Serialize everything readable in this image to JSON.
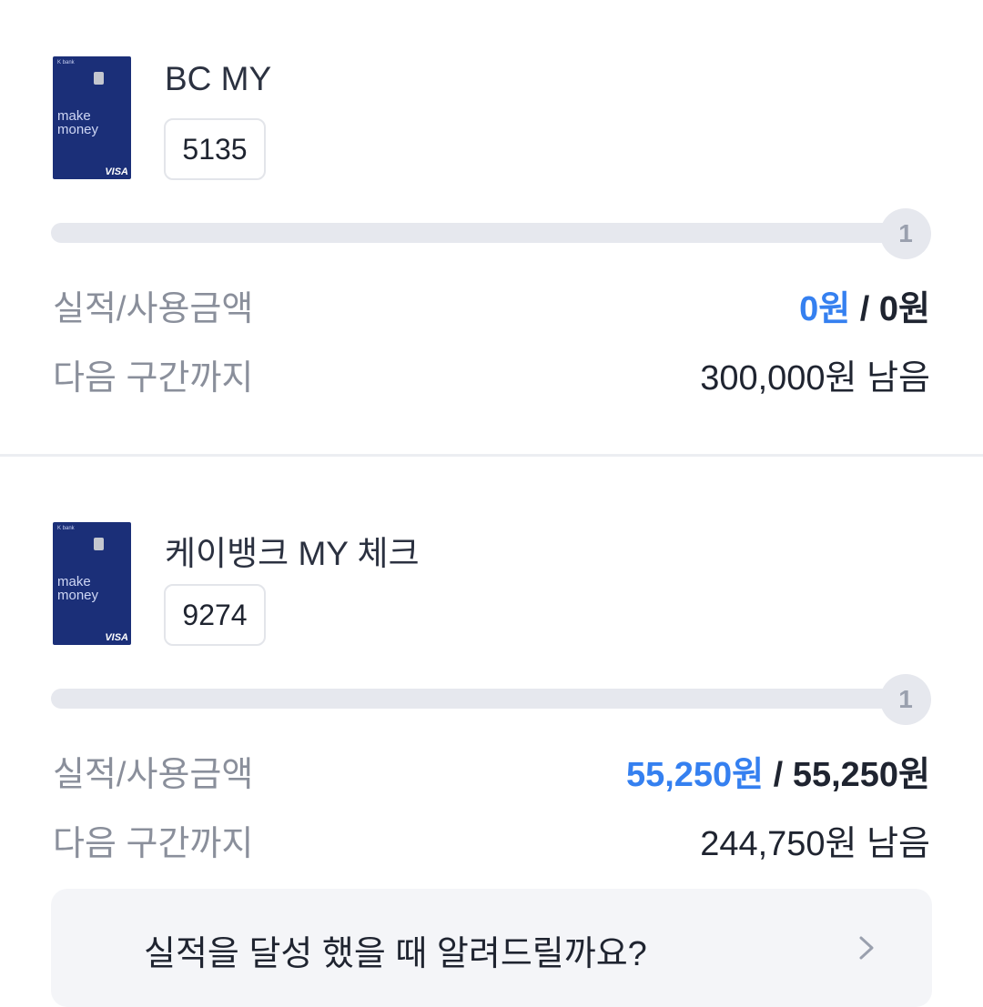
{
  "cards": [
    {
      "image": {
        "brand": "K bank",
        "slogan_line1": "make",
        "slogan_line2": "money",
        "network": "VISA"
      },
      "name": "BC MY",
      "number": "5135",
      "step": "1",
      "progress_fraction": 0,
      "perf_label": "실적/사용금액",
      "perf_achieved": "0원",
      "perf_separator": " / ",
      "perf_required": "0원",
      "remain_label": "다음 구간까지",
      "remain_value": "300,000원 남음"
    },
    {
      "image": {
        "brand": "K bank",
        "slogan_line1": "make",
        "slogan_line2": "money",
        "network": "VISA"
      },
      "name": "케이뱅크 MY 체크",
      "number": "9274",
      "step": "1",
      "progress_fraction": 0,
      "perf_label": "실적/사용금액",
      "perf_achieved": "55,250원",
      "perf_separator": " / ",
      "perf_required": "55,250원",
      "remain_label": "다음 구간까지",
      "remain_value": "244,750원 남음"
    }
  ],
  "notify_banner": {
    "text": "실적을 달성 했을 때 알려드릴까요?",
    "icon": "chevron-right-icon"
  },
  "colors": {
    "accent_blue": "#3580f0",
    "card_navy": "#1b2f78",
    "track_gray": "#e6e8ee",
    "label_gray": "#8a8f9b"
  }
}
